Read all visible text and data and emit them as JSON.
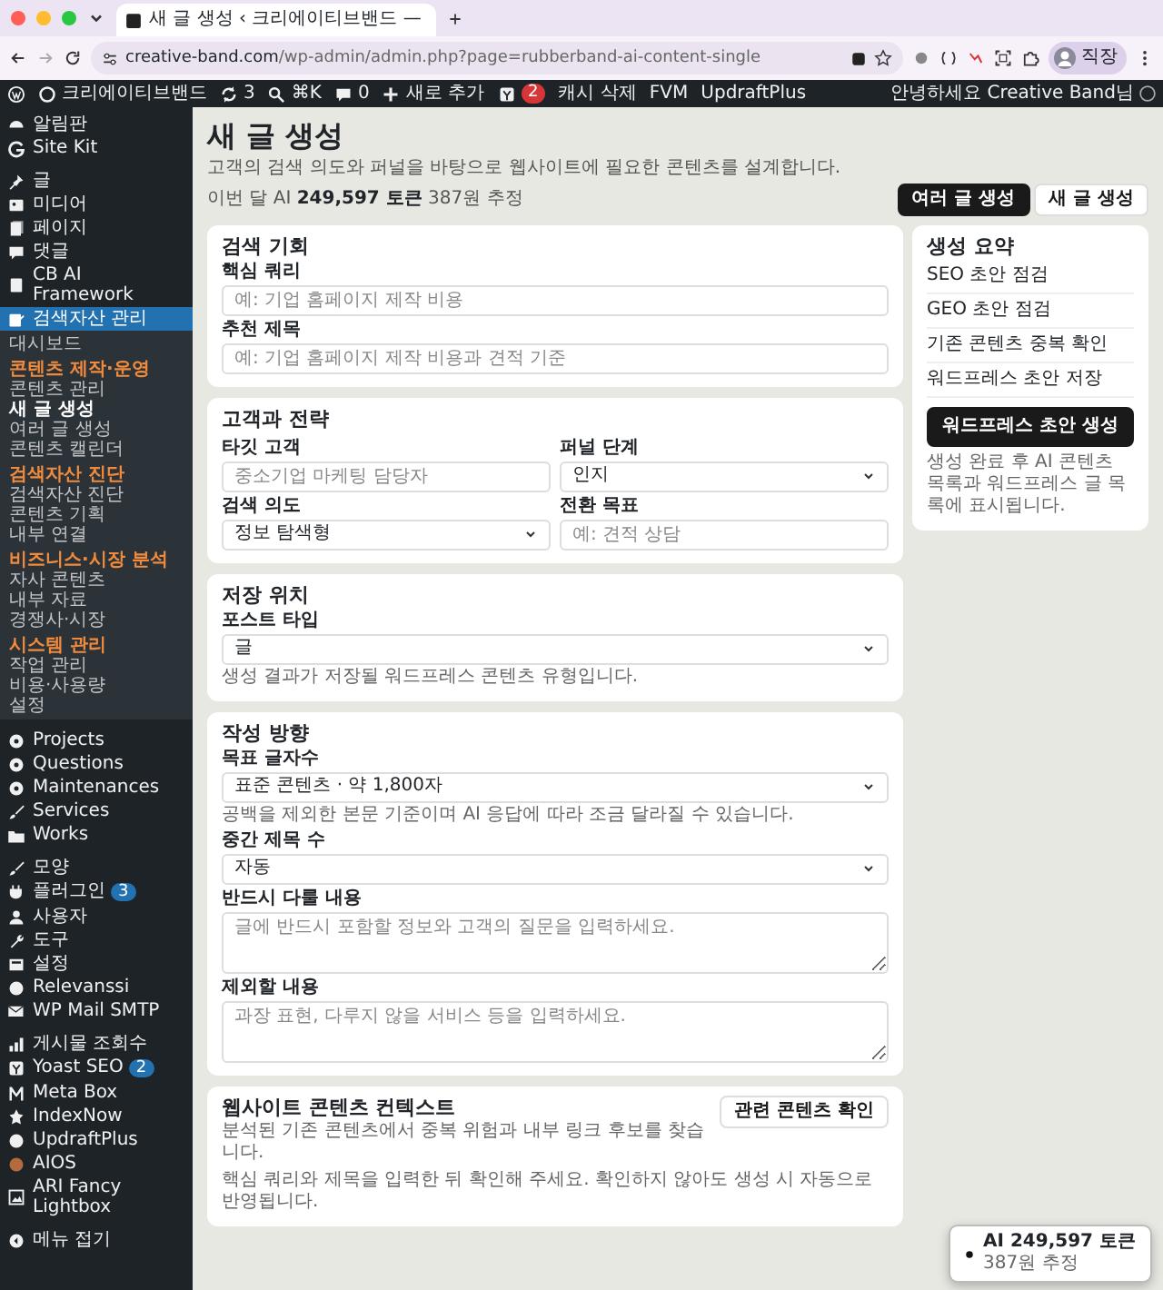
{
  "browser": {
    "tab_title": "새 글 생성 ‹ 크리에이티브밴드 —",
    "url_host": "creative-band.com",
    "url_path": "/wp-admin/admin.php?page=rubberband-ai-content-single",
    "profile_label": "직장"
  },
  "admin_bar": {
    "items": [
      {
        "label": "크리에이티브밴드"
      },
      {
        "label": "3"
      },
      {
        "label": "⌘K"
      },
      {
        "label": "0"
      },
      {
        "label": "새로 추가"
      },
      {
        "badge": "2"
      },
      {
        "label": "캐시 삭제"
      },
      {
        "label": "FVM"
      },
      {
        "label": "UpdraftPlus"
      }
    ],
    "greeting": "안녕하세요 Creative Band님"
  },
  "sidebar": {
    "items": [
      {
        "kind": "menu",
        "label": "알림판",
        "selected": false
      },
      {
        "kind": "menu",
        "label": "Site Kit",
        "selected": false
      },
      {
        "kind": "menu",
        "label": "글",
        "selected": false
      },
      {
        "kind": "menu",
        "label": "미디어",
        "selected": false
      },
      {
        "kind": "menu",
        "label": "페이지",
        "selected": false
      },
      {
        "kind": "menu",
        "label": "댓글",
        "selected": false
      },
      {
        "kind": "menu",
        "label": "CB AI Framework",
        "selected": false
      },
      {
        "kind": "menu",
        "label": "검색자산 관리",
        "selected": true
      },
      {
        "kind": "sub",
        "label": "대시보드",
        "selected": false
      },
      {
        "kind": "heading",
        "label": "콘텐츠 제작·운영"
      },
      {
        "kind": "sub",
        "label": "콘텐츠 관리",
        "selected": false
      },
      {
        "kind": "sub",
        "label": "새 글 생성",
        "selected": true
      },
      {
        "kind": "sub",
        "label": "여러 글 생성",
        "selected": false
      },
      {
        "kind": "sub",
        "label": "콘텐츠 캘린더",
        "selected": false
      },
      {
        "kind": "heading",
        "label": "검색자산 진단"
      },
      {
        "kind": "sub",
        "label": "검색자산 진단",
        "selected": false
      },
      {
        "kind": "sub",
        "label": "콘텐츠 기획",
        "selected": false
      },
      {
        "kind": "sub",
        "label": "내부 연결",
        "selected": false
      },
      {
        "kind": "heading",
        "label": "비즈니스·시장 분석"
      },
      {
        "kind": "sub",
        "label": "자사 콘텐츠",
        "selected": false
      },
      {
        "kind": "sub",
        "label": "내부 자료",
        "selected": false
      },
      {
        "kind": "sub",
        "label": "경쟁사·시장",
        "selected": false
      },
      {
        "kind": "heading",
        "label": "시스템 관리"
      },
      {
        "kind": "sub",
        "label": "작업 관리",
        "selected": false
      },
      {
        "kind": "sub",
        "label": "비용·사용량",
        "selected": false
      },
      {
        "kind": "sub",
        "label": "설정",
        "selected": false
      },
      {
        "kind": "menu",
        "label": "Projects",
        "selected": false
      },
      {
        "kind": "menu",
        "label": "Questions",
        "selected": false
      },
      {
        "kind": "menu",
        "label": "Maintenances",
        "selected": false
      },
      {
        "kind": "menu",
        "label": "Services",
        "selected": false
      },
      {
        "kind": "menu",
        "label": "Works",
        "selected": false
      },
      {
        "kind": "menu",
        "label": "모양",
        "selected": false
      },
      {
        "kind": "menu",
        "label": "플러그인",
        "badge": "3",
        "selected": false
      },
      {
        "kind": "menu",
        "label": "사용자",
        "selected": false
      },
      {
        "kind": "menu",
        "label": "도구",
        "selected": false
      },
      {
        "kind": "menu",
        "label": "설정",
        "selected": false
      },
      {
        "kind": "menu",
        "label": "Relevanssi",
        "selected": false
      },
      {
        "kind": "menu",
        "label": "WP Mail SMTP",
        "selected": false
      },
      {
        "kind": "menu",
        "label": "게시물 조회수",
        "selected": false
      },
      {
        "kind": "menu",
        "label": "Yoast SEO",
        "badge": "2",
        "selected": false
      },
      {
        "kind": "menu",
        "label": "Meta Box",
        "selected": false
      },
      {
        "kind": "menu",
        "label": "IndexNow",
        "selected": false
      },
      {
        "kind": "menu",
        "label": "UpdraftPlus",
        "selected": false
      },
      {
        "kind": "menu",
        "label": "AIOS",
        "selected": false
      },
      {
        "kind": "menu",
        "label": "ARI Fancy Lightbox",
        "selected": false
      },
      {
        "kind": "menu",
        "label": "메뉴 접기",
        "selected": false
      }
    ]
  },
  "header": {
    "title": "새 글 생성",
    "subtitle": "고객의 검색 의도와 퍼널을 바탕으로 웹사이트에 필요한 콘텐츠를 설계합니다.",
    "usage": {
      "prefix": "이번 달 AI",
      "tokens": "249,597 토큰",
      "cost": "387원 추정"
    },
    "actions": [
      {
        "label": "여러 글 생성",
        "kind": "dark"
      },
      {
        "label": "새 글 생성",
        "kind": "light"
      }
    ]
  },
  "sections": [
    {
      "title": "검색 기회",
      "fields": [
        {
          "kind": "input",
          "label": "핵심 쿼리",
          "placeholder": "예: 기업 홈페이지 제작 비용"
        },
        {
          "kind": "input",
          "label": "추천 제목",
          "placeholder": "예: 기업 홈페이지 제작 비용과 견적 기준"
        }
      ]
    },
    {
      "title": "고객과 전략",
      "fields": [
        {
          "kind": "input",
          "label": "타깃 고객",
          "placeholder": "중소기업 마케팅 담당자"
        },
        {
          "kind": "select",
          "label": "퍼널 단계",
          "value": "인지"
        },
        {
          "kind": "select",
          "label": "검색 의도",
          "value": "정보 탐색형"
        },
        {
          "kind": "input",
          "label": "전환 목표",
          "placeholder": "예: 견적 상담"
        }
      ]
    },
    {
      "title": "저장 위치",
      "fields": [
        {
          "kind": "select",
          "label": "포스트 타입",
          "value": "글",
          "help": "생성 결과가 저장될 워드프레스 콘텐츠 유형입니다."
        }
      ]
    },
    {
      "title": "작성 방향",
      "fields": [
        {
          "kind": "select",
          "label": "목표 글자수",
          "value": "표준 콘텐츠 · 약 1,800자",
          "help": "공백을 제외한 본문 기준이며 AI 응답에 따라 조금 달라질 수 있습니다."
        },
        {
          "kind": "select",
          "label": "중간 제목 수",
          "value": "자동"
        },
        {
          "kind": "textarea",
          "label": "반드시 다룰 내용",
          "placeholder": "글에 반드시 포함할 정보와 고객의 질문을 입력하세요."
        },
        {
          "kind": "textarea",
          "label": "제외할 내용",
          "placeholder": "과장 표현, 다루지 않을 서비스 등을 입력하세요."
        }
      ]
    }
  ],
  "context": {
    "title": "웹사이트 콘텐츠 컨텍스트",
    "subtitle": "분석된 기존 콘텐츠에서 중복 위험과 내부 링크 후보를 찾습니다.",
    "button": "관련 콘텐츠 확인",
    "note": "핵심 쿼리와 제목을 입력한 뒤 확인해 주세요. 확인하지 않아도 생성 시 자동으로 반영됩니다."
  },
  "summary": {
    "title": "생성 요약",
    "items": [
      "SEO 초안 점검",
      "GEO 초안 점검",
      "기존 콘텐츠 중복 확인",
      "워드프레스 초안 저장"
    ],
    "button": "워드프레스 초안 생성",
    "note": "생성 완료 후 AI 콘텐츠 목록과 워드프레스 글 목록에 표시됩니다."
  },
  "token_badge": {
    "tokens": "AI 249,597 토큰",
    "cost": "387원 추정"
  }
}
